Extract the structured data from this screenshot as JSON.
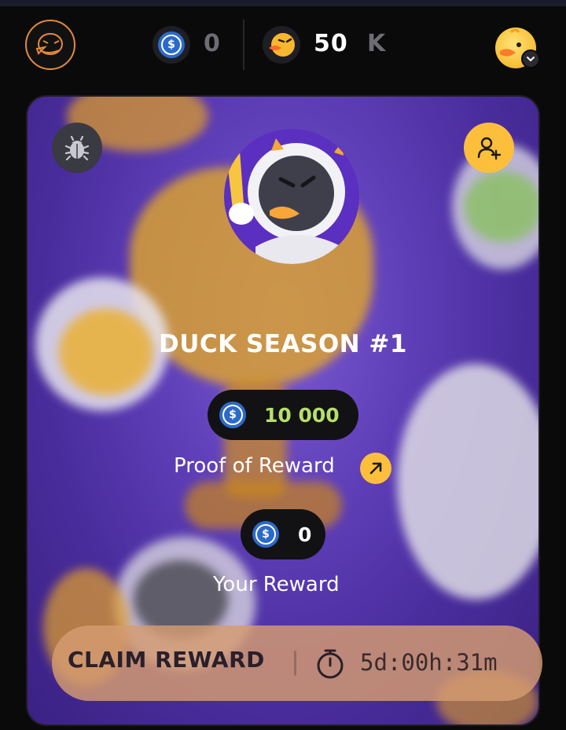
{
  "header": {
    "usdc_balance": "0",
    "eggs_balance": "50",
    "eggs_suffix": "K",
    "icons": [
      "duck-logo-icon",
      "usdc-coin-icon",
      "duck-token-icon",
      "user-avatar-icon",
      "chevron-down-icon"
    ]
  },
  "card": {
    "title": "DUCK SEASON #1",
    "prize_pool": "10 000",
    "proof_label": "Proof of Reward",
    "your_reward_value": "0",
    "your_reward_label": "Your Reward",
    "claim_label": "CLAIM REWARD",
    "timer": "5d:00h:31m",
    "icons": [
      "bug-icon",
      "add-user-icon",
      "arrow-up-right-icon",
      "timer-icon"
    ]
  },
  "colors": {
    "accent_yellow": "#fdbf3b",
    "prize_green": "#b6e06a",
    "card_purple": "#5f3fb8",
    "usdc_blue": "#2c6ac9",
    "claim_bar": "#d69c70"
  }
}
